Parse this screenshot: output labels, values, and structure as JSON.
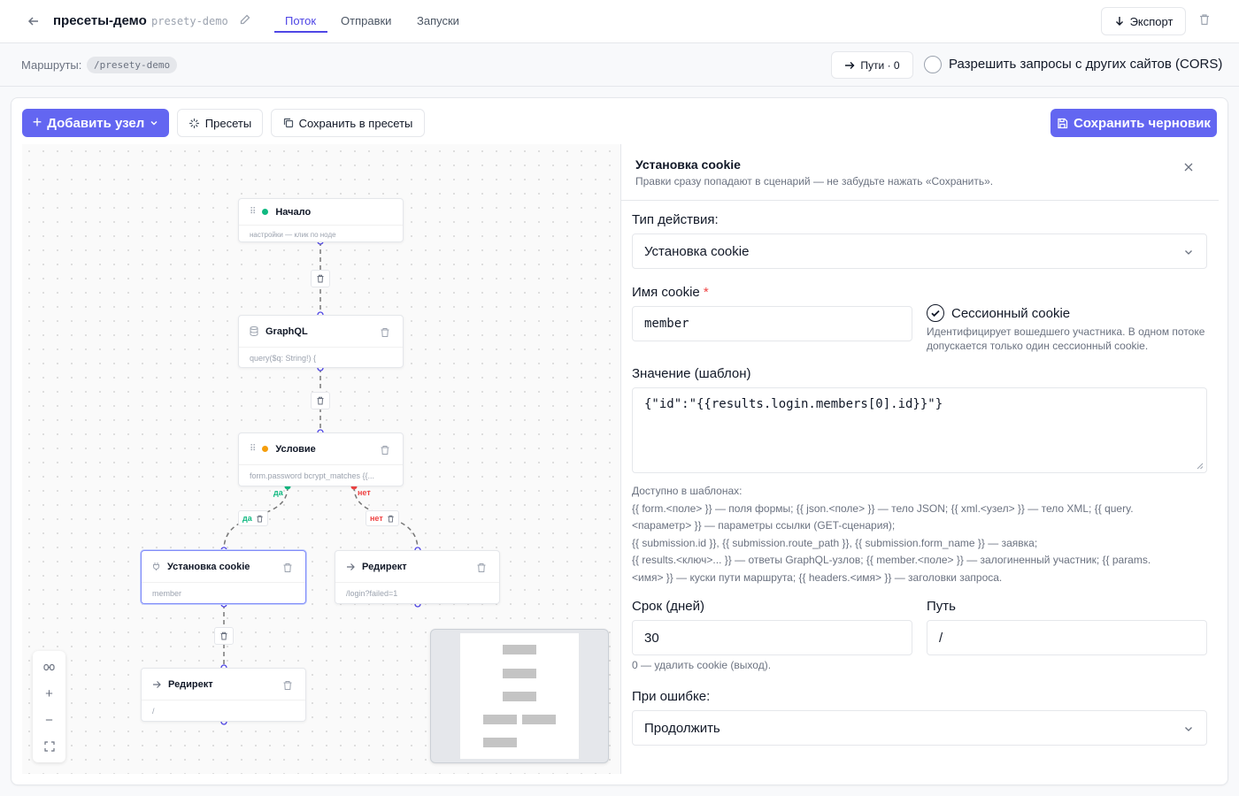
{
  "header": {
    "title": "пресеты-демо",
    "slug": "presety-demo",
    "tabs": [
      {
        "label": "Поток",
        "active": true
      },
      {
        "label": "Отправки",
        "active": false
      },
      {
        "label": "Запуски",
        "active": false
      }
    ],
    "export_label": "Экспорт"
  },
  "routes_bar": {
    "label": "Маршруты:",
    "route": "/presety-demo",
    "paths_label": "Пути · 0",
    "cors_label": "Разрешить запросы с других сайтов (CORS)",
    "cors_checked": false
  },
  "toolbar": {
    "add_node_label": "Добавить узел",
    "presets_label": "Пресеты",
    "save_presets_label": "Сохранить в пресеты",
    "save_draft_label": "Сохранить черновик"
  },
  "colors": {
    "accent": "#6366f1",
    "start_dot": "#10b981",
    "condition_dot": "#f59e0b",
    "yes": "#10b981",
    "no": "#ef4444"
  },
  "flow": {
    "nodes": {
      "start": {
        "title": "Начало",
        "body": "настройки — клик по ноде"
      },
      "graphql": {
        "title": "GraphQL",
        "body": "query($q: String!) {"
      },
      "condition": {
        "title": "Условие",
        "body": "form.password bcrypt_matches {{..."
      },
      "set_cookie": {
        "title": "Установка cookie",
        "body": "member"
      },
      "redirect_fail": {
        "title": "Редирект",
        "body": "/login?failed=1"
      },
      "redirect_ok": {
        "title": "Редирект",
        "body": "/"
      }
    },
    "yes_label": "да",
    "no_label": "нет"
  },
  "panel": {
    "title": "Установка cookie",
    "subtitle": "Правки сразу попадают в сценарий — не забудьте нажать «Сохранить».",
    "action_type_label": "Тип действия:",
    "action_type_value": "Установка cookie",
    "cookie_name_label": "Имя cookie",
    "cookie_name_value": "member",
    "session_label": "Сессионный cookie",
    "session_checked": true,
    "session_hint": "Идентифицирует вошедшего участника. В одном потоке допускается только один сессионный cookie.",
    "value_label": "Значение (шаблон)",
    "value_template": "{\"id\":\"{{results.login.members[0].id}}\"}",
    "templates_hint_title": "Доступно в шаблонах:",
    "templates_hint": [
      "{{ form.<поле> }} — поля формы; {{ json.<поле> }} — тело JSON; {{ xml.<узел> }} — тело XML; {{ query.",
      "<параметр> }} — параметры ссылки (GET-сценария);",
      "{{ submission.id }}, {{ submission.route_path }}, {{ submission.form_name }} — заявка;",
      "{{ results.<ключ>... }} — ответы GraphQL-узлов; {{ member.<поле> }} — залогиненный участник; {{ params.",
      "<имя> }} — куски пути маршрута; {{ headers.<имя> }} — заголовки запроса."
    ],
    "days_label": "Срок (дней)",
    "days_value": "30",
    "days_hint": "0 — удалить cookie (выход).",
    "path_label": "Путь",
    "path_value": "/",
    "on_error_label": "При ошибке:",
    "on_error_value": "Продолжить"
  }
}
